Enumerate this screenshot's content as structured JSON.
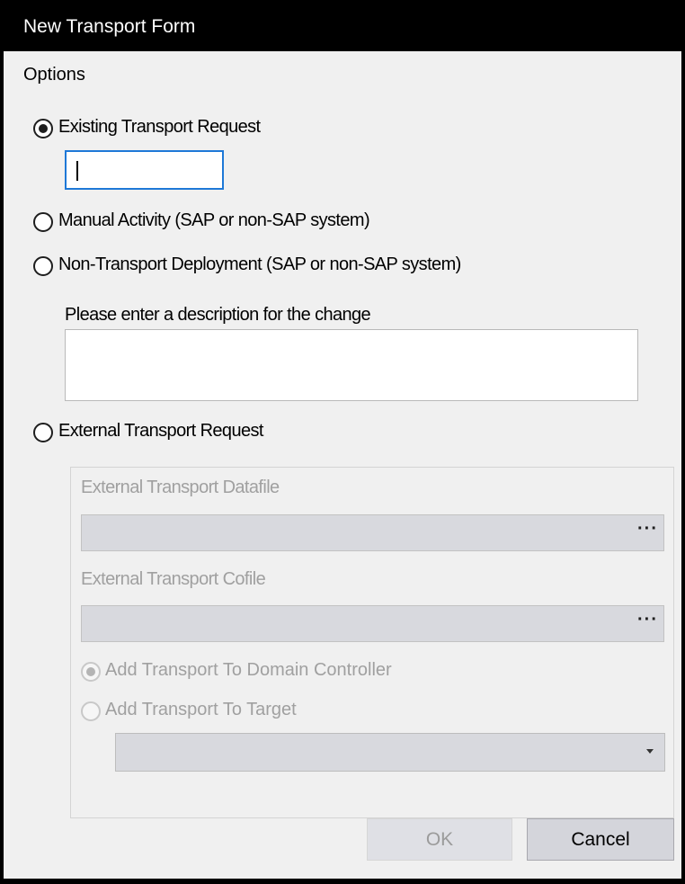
{
  "window": {
    "title": "New Transport Form"
  },
  "options": {
    "heading": "Options",
    "existing": {
      "label": "Existing Transport Request",
      "selected": true,
      "value": ""
    },
    "manual": {
      "label": "Manual Activity (SAP or non-SAP system)",
      "selected": false
    },
    "non_transport": {
      "label": "Non-Transport Deployment (SAP or non-SAP system)",
      "selected": false
    },
    "description": {
      "label": "Please enter a description for the change",
      "value": ""
    },
    "external": {
      "label": "External Transport Request",
      "selected": false
    }
  },
  "external_group": {
    "datafile": {
      "label": "External Transport Datafile",
      "value": "",
      "browse_label": "···"
    },
    "cofile": {
      "label": "External Transport Cofile",
      "value": "",
      "browse_label": "···"
    },
    "domain_controller": {
      "label": "Add Transport To Domain Controller",
      "selected": true,
      "enabled": false
    },
    "target": {
      "label": "Add Transport To Target",
      "selected": false,
      "enabled": false
    },
    "target_select": {
      "value": ""
    }
  },
  "buttons": {
    "ok": "OK",
    "cancel": "Cancel"
  },
  "colors": {
    "title_bar": "#000000",
    "dialog_bg": "#f0f0f0",
    "focus_border": "#1e78d7",
    "disabled_text": "#a0a0a0"
  }
}
